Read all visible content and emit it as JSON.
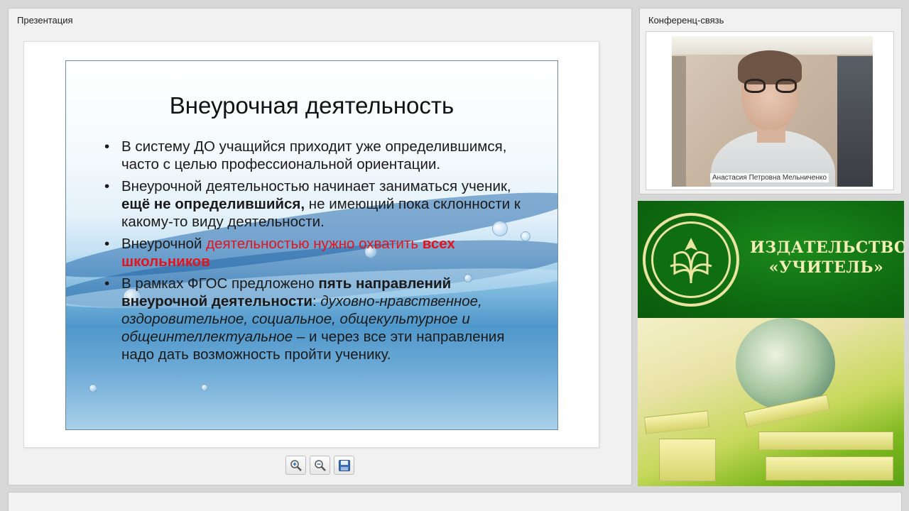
{
  "presentation": {
    "title": "Презентация",
    "slide": {
      "title": "Внеурочная деятельность",
      "b1": "В систему ДО учащийся приходит уже определившимся, часто с целью профессиональной ориентации.",
      "b2_a": "Внеурочной деятельностью начинает заниматься ученик, ",
      "b2_bold": "ещё не определившийся,",
      "b2_b": " не имеющий пока склонности к какому-то виду деятельности.",
      "b3_a": "Внеурочной ",
      "b3_red": "деятельностью нужно охватить ",
      "b3_bold": "всех школьников",
      "b4_a": "В рамках ФГОС предложено ",
      "b4_bold1": "пять направлений внеурочной деятельности",
      "b4_colon": ": ",
      "b4_italic1": "духовно-нравственное, оздоровительное, социальное, общекультурное и общеинтеллектуальное",
      "b4_b": " – и через все эти направления надо дать возможность пройти ученику."
    },
    "toolbar": {
      "zoom_in_icon": "zoom-in-icon",
      "zoom_out_icon": "zoom-out-icon",
      "save_icon": "save-icon"
    }
  },
  "conference": {
    "title": "Конференц-связь",
    "speaker_name": "Анастасия Петровна Мельниченко"
  },
  "ad": {
    "publisher_line1": "ИЗДАТЕЛЬСТВО",
    "publisher_line2": "«УЧИТЕЛЬ»"
  },
  "colors": {
    "accent_red": "#e3141b",
    "ad_green": "#0e6a10",
    "ad_text": "#f2eeb5"
  }
}
